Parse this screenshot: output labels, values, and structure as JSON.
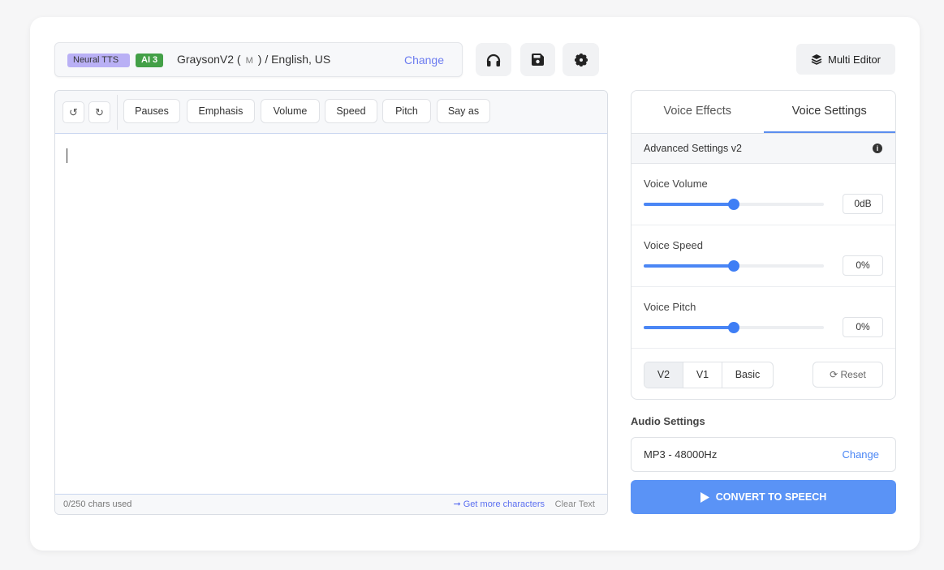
{
  "voice": {
    "badge_engine": "Neural TTS",
    "badge_ai": "AI 3",
    "name": "GraysonV2 (",
    "gender": "M",
    "lang": ") / English, US",
    "change": "Change"
  },
  "toolbar_icons": [
    "headphones-icon",
    "save-icon",
    "gear-icon"
  ],
  "multi_editor": "Multi Editor",
  "editor": {
    "buttons": [
      "Pauses",
      "Emphasis",
      "Volume",
      "Speed",
      "Pitch",
      "Say as"
    ],
    "text": "",
    "chars_used": "0/250 chars used",
    "get_more": "➞ Get more characters",
    "clear": "Clear Text"
  },
  "panel": {
    "tabs": [
      "Voice Effects",
      "Voice Settings"
    ],
    "active_tab": "Voice Settings",
    "advanced": "Advanced Settings v2",
    "sliders": [
      {
        "label": "Voice Volume",
        "value": "0dB",
        "position": 0.5
      },
      {
        "label": "Voice Speed",
        "value": "0%",
        "position": 0.5
      },
      {
        "label": "Voice Pitch",
        "value": "0%",
        "position": 0.5
      }
    ],
    "versions": [
      "V2",
      "V1",
      "Basic"
    ],
    "selected_version": "V2",
    "reset": "Reset"
  },
  "audio": {
    "label": "Audio Settings",
    "format": "MP3 - 48000Hz",
    "change": "Change"
  },
  "convert": "CONVERT TO SPEECH",
  "colors": {
    "accent": "#5a93f6",
    "link": "#6c7cf0",
    "badge_ai": "#43a047",
    "badge_neural": "#b9b0f5"
  }
}
